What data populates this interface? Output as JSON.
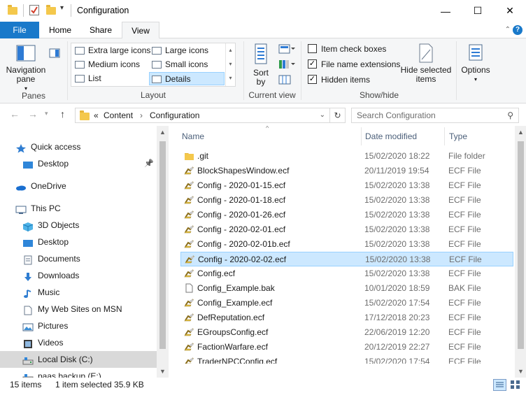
{
  "window": {
    "title": "Configuration",
    "minimize_glyph": "—",
    "maximize_glyph": "☐",
    "close_glyph": "✕"
  },
  "ribbon_tabs": [
    "File",
    "Home",
    "Share",
    "View"
  ],
  "ribbon": {
    "panes": {
      "label": "Panes",
      "navigation_pane": "Navigation pane",
      "navigation_pane_line1": "Navigation",
      "navigation_pane_line2": "pane"
    },
    "layout": {
      "label": "Layout",
      "options": [
        "Extra large icons",
        "Large icons",
        "Medium icons",
        "Small icons",
        "List",
        "Details"
      ],
      "selected": "Details"
    },
    "current_view": {
      "label": "Current view",
      "sort_by_line1": "Sort",
      "sort_by_line2": "by"
    },
    "show_hide": {
      "label": "Show/hide",
      "item_check_boxes": "Item check boxes",
      "file_name_extensions": "File name extensions",
      "hidden_items": "Hidden items",
      "hide_selected_line1": "Hide selected",
      "hide_selected_line2": "items"
    },
    "options": {
      "label": "Options"
    }
  },
  "checkboxes": {
    "item_check_boxes": false,
    "file_name_extensions": true,
    "hidden_items": true
  },
  "address": {
    "prefix": "«",
    "crumbs": [
      "Content",
      "Configuration"
    ],
    "separator": "›"
  },
  "search": {
    "placeholder": "Search Configuration"
  },
  "nav_pane": [
    {
      "label": "Quick access",
      "icon": "star-icon"
    },
    {
      "label": "Desktop",
      "icon": "desktop-icon",
      "pinned": true
    },
    {
      "label": "OneDrive",
      "icon": "cloud-icon"
    },
    {
      "label": "This PC",
      "icon": "pc-icon"
    },
    {
      "label": "3D Objects",
      "icon": "cube-icon"
    },
    {
      "label": "Desktop",
      "icon": "desktop-icon"
    },
    {
      "label": "Documents",
      "icon": "documents-icon"
    },
    {
      "label": "Downloads",
      "icon": "download-icon"
    },
    {
      "label": "Music",
      "icon": "music-icon"
    },
    {
      "label": "My Web Sites on MSN",
      "icon": "document-icon"
    },
    {
      "label": "Pictures",
      "icon": "pictures-icon"
    },
    {
      "label": "Videos",
      "icon": "videos-icon"
    },
    {
      "label": "Local Disk (C:)",
      "icon": "drive-icon",
      "selected": true
    },
    {
      "label": "paas backup (E:)",
      "icon": "drive-icon"
    }
  ],
  "columns": {
    "name": "Name",
    "date": "Date modified",
    "type": "Type"
  },
  "files": [
    {
      "name": ".git",
      "date": "15/02/2020 18:22",
      "type": "File folder",
      "icon": "folder-icon"
    },
    {
      "name": "BlockShapesWindow.ecf",
      "date": "20/11/2019 19:54",
      "type": "ECF File",
      "icon": "ecf-file-icon"
    },
    {
      "name": "Config - 2020-01-15.ecf",
      "date": "15/02/2020 13:38",
      "type": "ECF File",
      "icon": "ecf-file-icon"
    },
    {
      "name": "Config - 2020-01-18.ecf",
      "date": "15/02/2020 13:38",
      "type": "ECF File",
      "icon": "ecf-file-icon"
    },
    {
      "name": "Config - 2020-01-26.ecf",
      "date": "15/02/2020 13:38",
      "type": "ECF File",
      "icon": "ecf-file-icon"
    },
    {
      "name": "Config - 2020-02-01.ecf",
      "date": "15/02/2020 13:38",
      "type": "ECF File",
      "icon": "ecf-file-icon"
    },
    {
      "name": "Config - 2020-02-01b.ecf",
      "date": "15/02/2020 13:38",
      "type": "ECF File",
      "icon": "ecf-file-icon"
    },
    {
      "name": "Config - 2020-02-02.ecf",
      "date": "15/02/2020 13:38",
      "type": "ECF File",
      "icon": "ecf-file-icon",
      "selected": true
    },
    {
      "name": "Config.ecf",
      "date": "15/02/2020 13:38",
      "type": "ECF File",
      "icon": "ecf-file-icon"
    },
    {
      "name": "Config_Example.bak",
      "date": "10/01/2020 18:59",
      "type": "BAK File",
      "icon": "blank-file-icon"
    },
    {
      "name": "Config_Example.ecf",
      "date": "15/02/2020 17:54",
      "type": "ECF File",
      "icon": "ecf-file-icon"
    },
    {
      "name": "DefReputation.ecf",
      "date": "17/12/2018 20:23",
      "type": "ECF File",
      "icon": "ecf-file-icon"
    },
    {
      "name": "EGroupsConfig.ecf",
      "date": "22/06/2019 12:20",
      "type": "ECF File",
      "icon": "ecf-file-icon"
    },
    {
      "name": "FactionWarfare.ecf",
      "date": "20/12/2019 22:27",
      "type": "ECF File",
      "icon": "ecf-file-icon"
    },
    {
      "name": "TraderNPCConfig.ecf",
      "date": "15/02/2020 17:54",
      "type": "ECF File",
      "icon": "ecf-file-icon"
    }
  ],
  "status": {
    "item_count": "15 items",
    "selection": "1 item selected  35.9 KB"
  },
  "colors": {
    "accent": "#1979ca",
    "selection": "#cce8ff",
    "selection_border": "#99d1ff",
    "folder": "#f4c84c"
  }
}
